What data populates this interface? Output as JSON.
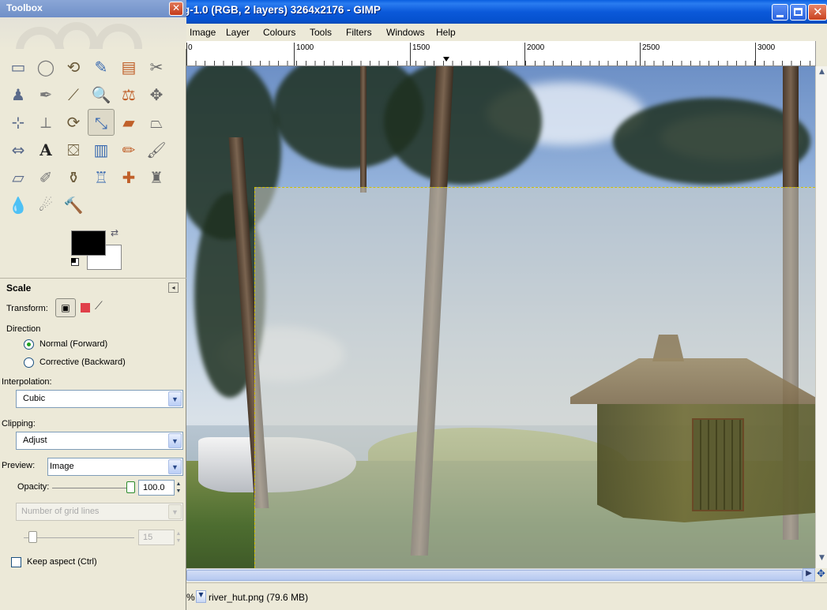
{
  "main_window": {
    "title": "g-1.0 (RGB, 2 layers) 3264x2176 - GIMP",
    "menu": [
      "Image",
      "Layer",
      "Colours",
      "Tools",
      "Filters",
      "Windows",
      "Help"
    ],
    "ruler_labels": [
      "0",
      "1000",
      "1500",
      "2000",
      "2500",
      "3000"
    ],
    "status": {
      "unit": "%",
      "file_info": "river_hut.png (79.6 MB)"
    }
  },
  "toolbox": {
    "title": "Toolbox",
    "tools": [
      {
        "icon": "rect-select-icon",
        "glyph": "▭"
      },
      {
        "icon": "ellipse-select-icon",
        "glyph": "◯"
      },
      {
        "icon": "free-select-icon",
        "glyph": "⟲"
      },
      {
        "icon": "fuzzy-select-icon",
        "glyph": "✎"
      },
      {
        "icon": "select-by-color-icon",
        "glyph": "▤"
      },
      {
        "icon": "scissors-icon",
        "glyph": "✂"
      },
      {
        "icon": "foreground-select-icon",
        "glyph": "♟"
      },
      {
        "icon": "paths-icon",
        "glyph": "✒"
      },
      {
        "icon": "color-picker-icon",
        "glyph": "⟋"
      },
      {
        "icon": "magnify-icon",
        "glyph": "🔍"
      },
      {
        "icon": "measure-icon",
        "glyph": "⚖"
      },
      {
        "icon": "move-icon",
        "glyph": "✥"
      },
      {
        "icon": "align-icon",
        "glyph": "⊹"
      },
      {
        "icon": "crop-icon",
        "glyph": "⟂"
      },
      {
        "icon": "rotate-icon",
        "glyph": "⟳"
      },
      {
        "icon": "scale-icon",
        "glyph": "⤡"
      },
      {
        "icon": "shear-icon",
        "glyph": "▰"
      },
      {
        "icon": "perspective-icon",
        "glyph": "⏢"
      },
      {
        "icon": "flip-icon",
        "glyph": "⇔"
      },
      {
        "icon": "text-icon",
        "glyph": "A"
      },
      {
        "icon": "bucket-fill-icon",
        "glyph": "⛋"
      },
      {
        "icon": "blend-icon",
        "glyph": "▥"
      },
      {
        "icon": "pencil-icon",
        "glyph": "✏"
      },
      {
        "icon": "paintbrush-icon",
        "glyph": "🖌"
      },
      {
        "icon": "eraser-icon",
        "glyph": "▱"
      },
      {
        "icon": "airbrush-icon",
        "glyph": "✐"
      },
      {
        "icon": "ink-icon",
        "glyph": "⚱"
      },
      {
        "icon": "clone-icon",
        "glyph": "♖"
      },
      {
        "icon": "heal-icon",
        "glyph": "✚"
      },
      {
        "icon": "perspective-clone-icon",
        "glyph": "♜"
      },
      {
        "icon": "blur-sharpen-icon",
        "glyph": "💧"
      },
      {
        "icon": "smudge-icon",
        "glyph": "☄"
      },
      {
        "icon": "dodge-burn-icon",
        "glyph": "🔨"
      }
    ],
    "options": {
      "tool_name": "Scale",
      "transform_label": "Transform:",
      "direction_label": "Direction",
      "direction_normal": "Normal (Forward)",
      "direction_corrective": "Corrective (Backward)",
      "interpolation_label": "Interpolation:",
      "interpolation_value": "Cubic",
      "clipping_label": "Clipping:",
      "clipping_value": "Adjust",
      "preview_label": "Preview:",
      "preview_value": "Image",
      "opacity_label": "Opacity:",
      "opacity_value": "100.0",
      "grid_placeholder": "Number of grid lines",
      "grid_value": "15",
      "keep_aspect_label": "Keep aspect  (Ctrl)"
    }
  },
  "colors": {
    "title_bar_blue": "#0b59da",
    "toolbox_title": "#7a98cf",
    "selection_dash": "#d0c000"
  }
}
